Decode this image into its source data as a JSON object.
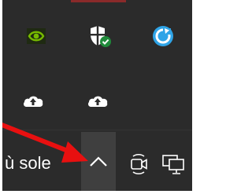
{
  "taskbar": {
    "language_fragment": "ù sole"
  },
  "tray_flyout": {
    "icons": [
      {
        "name": "nvidia-icon"
      },
      {
        "name": "windows-security-icon"
      },
      {
        "name": "sync-icon"
      },
      {
        "name": "cloud-upload-icon"
      },
      {
        "name": "cloud-upload-icon"
      }
    ]
  },
  "colors": {
    "taskbar_background": "#2b2b2b",
    "chevron_hover": "#3f3f3f",
    "nvidia_green": "#76b900",
    "security_badge": "#1f8a3a",
    "sync_blue": "#2fa4e7",
    "annotation_arrow": "#e81010"
  }
}
